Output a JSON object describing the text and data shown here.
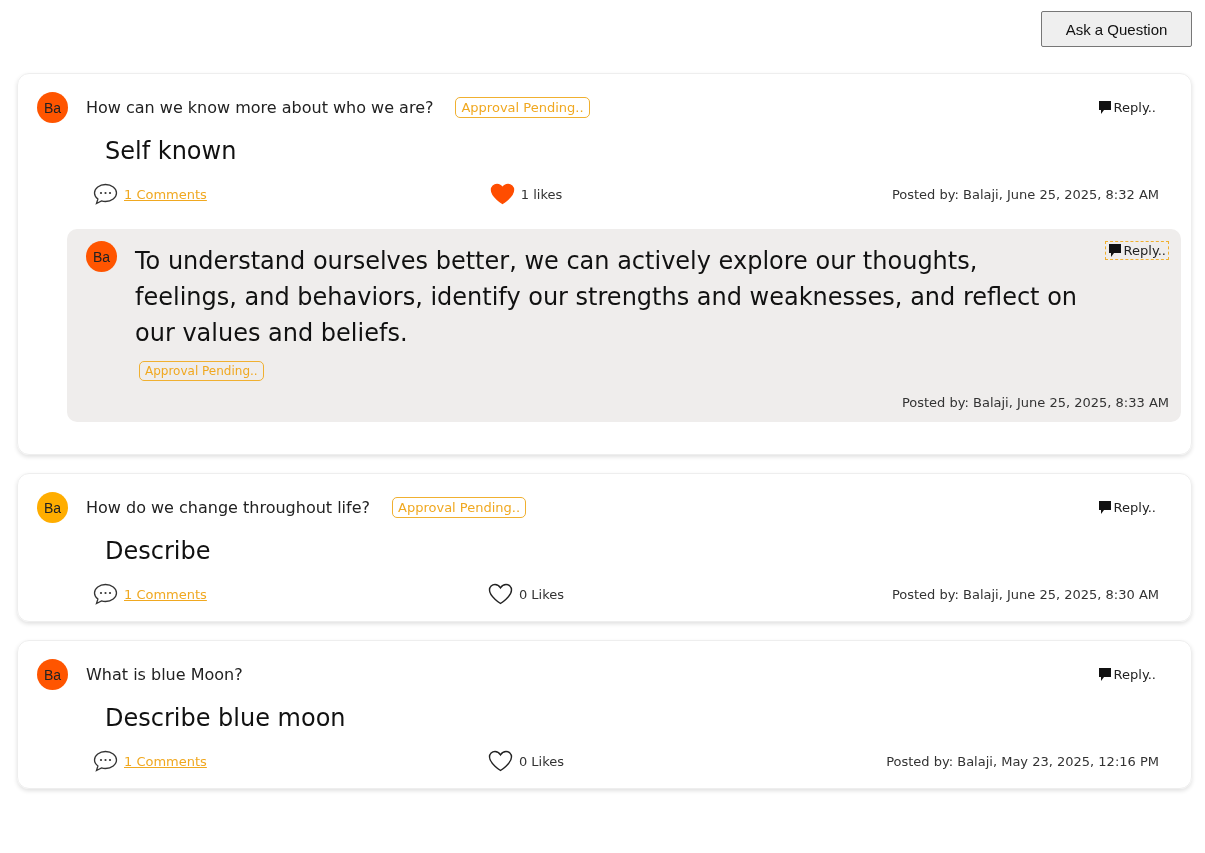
{
  "ask_button": "Ask a Question",
  "questions": [
    {
      "avatar": "Ba",
      "color": "#ff5500",
      "question": "How can we know more about who we are?",
      "status": "Approval Pending..",
      "reply": "Reply..",
      "title": "Self known",
      "comments": "1 Comments",
      "likes": "1 likes",
      "liked": true,
      "posted": "Posted by: Balaji, June 25, 2025, 8:32 AM",
      "answers": [
        {
          "avatar": "Ba",
          "color": "#ff5500",
          "text": "To understand ourselves better, we can actively explore our thoughts, feelings, and behaviors, identify our strengths and weaknesses, and reflect on our values and beliefs.",
          "status": "Approval Pending..",
          "reply": "Reply..",
          "focused": true,
          "posted": "Posted by: Balaji, June 25, 2025, 8:33 AM"
        }
      ]
    },
    {
      "avatar": "Ba",
      "color": "#ffad00",
      "question": "How do we change throughout life?",
      "status": "Approval Pending..",
      "reply": "Reply..",
      "title": "Describe",
      "comments": "1 Comments",
      "likes": "0 Likes",
      "liked": false,
      "posted": "Posted by: Balaji, June 25, 2025, 8:30 AM"
    },
    {
      "avatar": "Ba",
      "color": "#ff5500",
      "question": "What is blue Moon?",
      "reply": "Reply..",
      "title": "Describe blue moon",
      "comments": "1 Comments",
      "likes": "0 Likes",
      "liked": false,
      "posted": "Posted by: Balaji, May 23, 2025, 12:16 PM"
    }
  ]
}
